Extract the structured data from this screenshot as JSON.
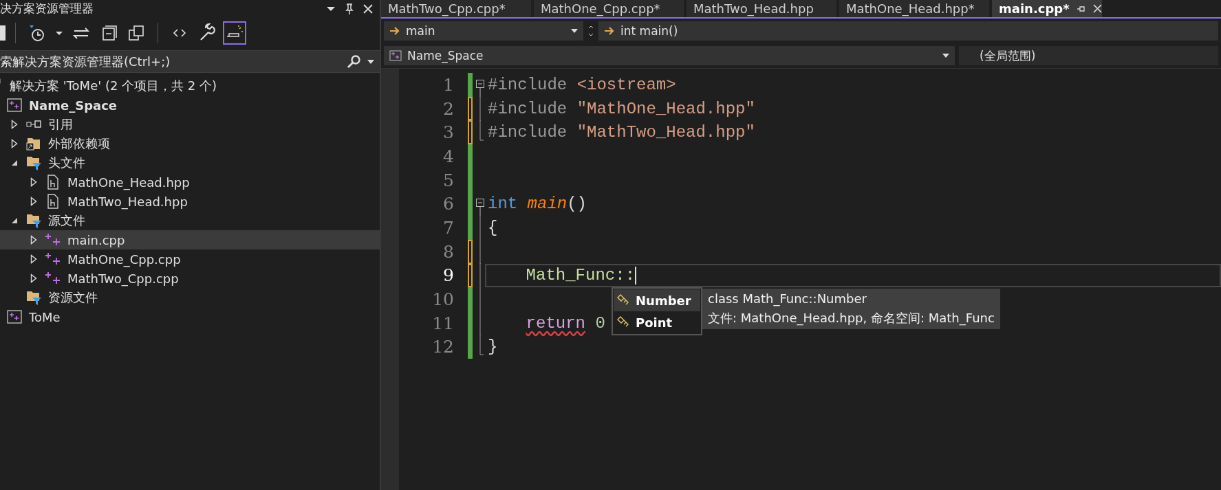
{
  "explorer": {
    "title": "决方案资源管理器",
    "toolbar": [
      {
        "kind": "partial",
        "on": false
      },
      {
        "kind": "history",
        "on": false
      },
      {
        "kind": "dropdown",
        "on": false
      },
      {
        "kind": "sync",
        "on": false
      },
      {
        "kind": "collapse",
        "on": false
      },
      {
        "kind": "copies",
        "on": false
      },
      {
        "kind": "code",
        "on": false
      },
      {
        "kind": "wrench",
        "on": false
      },
      {
        "kind": "preview",
        "on": true
      }
    ],
    "search": {
      "placeholder": "索解决方案资源管理器(Ctrl+;)"
    },
    "tree": [
      {
        "kind": "solution",
        "label": "解决方案 'ToMe' (2 个项目，共 2 个)",
        "selected": false,
        "children": [
          {
            "kind": "project",
            "label": "Name_Space",
            "startup": true,
            "selected": false,
            "children": [
              {
                "kind": "references",
                "label": "引用",
                "expanded": false,
                "selected": false
              },
              {
                "kind": "external",
                "label": "外部依赖项",
                "expanded": false,
                "selected": false
              },
              {
                "kind": "filter",
                "label": "头文件",
                "expanded": true,
                "selected": false,
                "children": [
                  {
                    "kind": "header",
                    "label": "MathOne_Head.hpp",
                    "expanded": false,
                    "selected": false
                  },
                  {
                    "kind": "header",
                    "label": "MathTwo_Head.hpp",
                    "expanded": false,
                    "selected": false
                  }
                ]
              },
              {
                "kind": "filter",
                "label": "源文件",
                "expanded": true,
                "selected": false,
                "children": [
                  {
                    "kind": "source",
                    "label": "main.cpp",
                    "expanded": false,
                    "selected": true
                  },
                  {
                    "kind": "source",
                    "label": "MathOne_Cpp.cpp",
                    "expanded": false,
                    "selected": false
                  },
                  {
                    "kind": "source",
                    "label": "MathTwo_Cpp.cpp",
                    "expanded": false,
                    "selected": false
                  }
                ]
              },
              {
                "kind": "filter",
                "label": "资源文件",
                "selected": false
              }
            ]
          },
          {
            "kind": "project",
            "label": "ToMe",
            "startup": false,
            "selected": false
          }
        ]
      }
    ]
  },
  "editor": {
    "tabs": [
      {
        "label": "MathTwo_Cpp.cpp*",
        "selected": false
      },
      {
        "label": "MathOne_Cpp.cpp*",
        "selected": false
      },
      {
        "label": "MathTwo_Head.hpp",
        "selected": false
      },
      {
        "label": "MathOne_Head.hpp*",
        "selected": false
      },
      {
        "label": "main.cpp*",
        "selected": true
      }
    ],
    "nav": {
      "scope": "main",
      "member": "int main()",
      "project": "Name_Space",
      "context": "(全局范围)"
    },
    "lines": [
      {
        "number": "1",
        "collapsible": true,
        "fold_end": false,
        "unsaved": false,
        "current": false,
        "tokens": [
          {
            "kind": "preproc",
            "text": "#include "
          },
          {
            "kind": "string",
            "text": "<iostream>"
          }
        ]
      },
      {
        "number": "2",
        "collapsible": false,
        "fold_end": false,
        "unsaved": true,
        "current": false,
        "tokens": [
          {
            "kind": "preproc",
            "text": "#include "
          },
          {
            "kind": "string",
            "text": "\"MathOne_Head.hpp\""
          }
        ]
      },
      {
        "number": "3",
        "collapsible": false,
        "fold_end": true,
        "unsaved": true,
        "current": false,
        "tokens": [
          {
            "kind": "preproc",
            "text": "#include "
          },
          {
            "kind": "string",
            "text": "\"MathTwo_Head.hpp\""
          }
        ]
      },
      {
        "number": "4",
        "collapsible": false,
        "fold_end": false,
        "unsaved": false,
        "current": false
      },
      {
        "number": "5",
        "collapsible": false,
        "fold_end": false,
        "unsaved": false,
        "current": false
      },
      {
        "number": "6",
        "collapsible": true,
        "fold_end": false,
        "unsaved": false,
        "current": false,
        "tokens": [
          {
            "kind": "keyword",
            "text": "int "
          },
          {
            "kind": "function",
            "text": "main"
          },
          {
            "kind": "plain",
            "text": "()"
          }
        ]
      },
      {
        "number": "7",
        "collapsible": false,
        "fold_end": false,
        "unsaved": false,
        "current": false,
        "tokens": [
          {
            "kind": "plain",
            "text": "{"
          }
        ]
      },
      {
        "number": "8",
        "collapsible": false,
        "fold_end": false,
        "unsaved": true,
        "current": false
      },
      {
        "number": "9",
        "collapsible": false,
        "fold_end": false,
        "unsaved": true,
        "current": true,
        "indented": true,
        "tokens": [
          {
            "kind": "namespace",
            "text": "Math_Func::"
          }
        ]
      },
      {
        "number": "10",
        "collapsible": false,
        "fold_end": false,
        "unsaved": false,
        "current": false
      },
      {
        "number": "11",
        "collapsible": false,
        "fold_end": false,
        "unsaved": false,
        "current": false,
        "indented": true,
        "tokens": [
          {
            "kind": "control",
            "text": "return",
            "error": true
          },
          {
            "kind": "number",
            "text": " 0"
          }
        ]
      },
      {
        "number": "12",
        "collapsible": false,
        "fold_end": true,
        "unsaved": false,
        "current": false,
        "tokens": [
          {
            "kind": "plain",
            "text": "}"
          }
        ]
      }
    ],
    "completion": {
      "items": [
        {
          "label": "Number",
          "selected": true
        },
        {
          "label": "Point",
          "selected": false
        }
      ],
      "tooltip": [
        "class Math_Func::Number",
        "文件: MathOne_Head.hpp, 命名空间: Math_Func"
      ]
    }
  }
}
